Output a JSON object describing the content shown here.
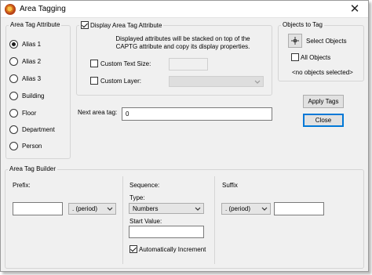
{
  "window": {
    "title": "Area Tagging"
  },
  "attribute_group": {
    "label": "Area Tag Attribute",
    "options": [
      "Alias 1",
      "Alias 2",
      "Alias 3",
      "Building",
      "Floor",
      "Department",
      "Person"
    ],
    "selected": "Alias 1"
  },
  "display_group": {
    "display_label": "Display Area Tag Attribute",
    "display_checked": true,
    "description": "Displayed attributes will be stacked on top of the CAPTG attribute and copy its display properties.",
    "custom_text_size_label": "Custom Text Size:",
    "custom_text_size_checked": false,
    "custom_text_size_value": "",
    "custom_layer_label": "Custom Layer:",
    "custom_layer_checked": false,
    "custom_layer_value": ""
  },
  "objects_group": {
    "label": "Objects to Tag",
    "select_objects_label": "Select Objects",
    "all_objects_label": "All Objects",
    "all_objects_checked": false,
    "status": "<no objects selected>"
  },
  "buttons": {
    "apply": "Apply Tags",
    "close": "Close"
  },
  "next_area_tag": {
    "label": "Next area tag:",
    "value": "0"
  },
  "builder": {
    "label": "Area Tag Builder",
    "prefix": {
      "label": "Prefix:",
      "value": "",
      "separator": ". (period)"
    },
    "sequence": {
      "label": "Sequence:",
      "type_label": "Type:",
      "type_value": "Numbers",
      "start_label": "Start Value:",
      "start_value": "",
      "auto_increment_label": "Automatically Increment",
      "auto_increment_checked": true
    },
    "suffix": {
      "label": "Suffix",
      "separator": ". (period)",
      "value": ""
    }
  }
}
